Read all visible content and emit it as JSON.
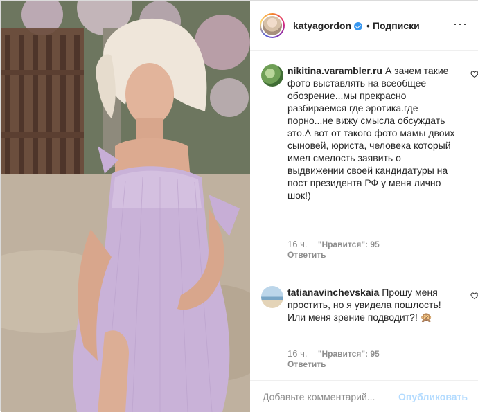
{
  "colors": {
    "accent": "#0095f6",
    "muted": "#8e8e8e",
    "publish_disabled": "#b3dbff",
    "verified": "#3897f0"
  },
  "photo": {
    "description_icon": "photo"
  },
  "header": {
    "username": "katyagordon",
    "separator": "•",
    "follow_label": "Подписки",
    "more_label": "···"
  },
  "comments": [
    {
      "username": "nikitina.varambler.ru",
      "text": "А зачем такие фото выставлять на всеобщее обозрение...мы прекрасно разбираемся где эротика.где порно...не вижу смысла обсуждать это.А вот от такого фото мамы двоих сыновей, юриста, человека который имел смелость заявить о выдвижении своей кандидатуры на пост президента РФ у меня лично шок!)",
      "time": "16 ч.",
      "likes": "\"Нравится\": 95",
      "reply": "Ответить"
    },
    {
      "username": "tatianavinchevskaia",
      "text": "Прошу меня простить, но я увидела пошлость! Или меня зрение подводит?! 🙊",
      "time": "16 ч.",
      "likes": "\"Нравится\": 95",
      "reply": "Ответить"
    }
  ],
  "add_comment": {
    "placeholder": "Добавьте комментарий...",
    "publish_label": "Опубликовать"
  }
}
